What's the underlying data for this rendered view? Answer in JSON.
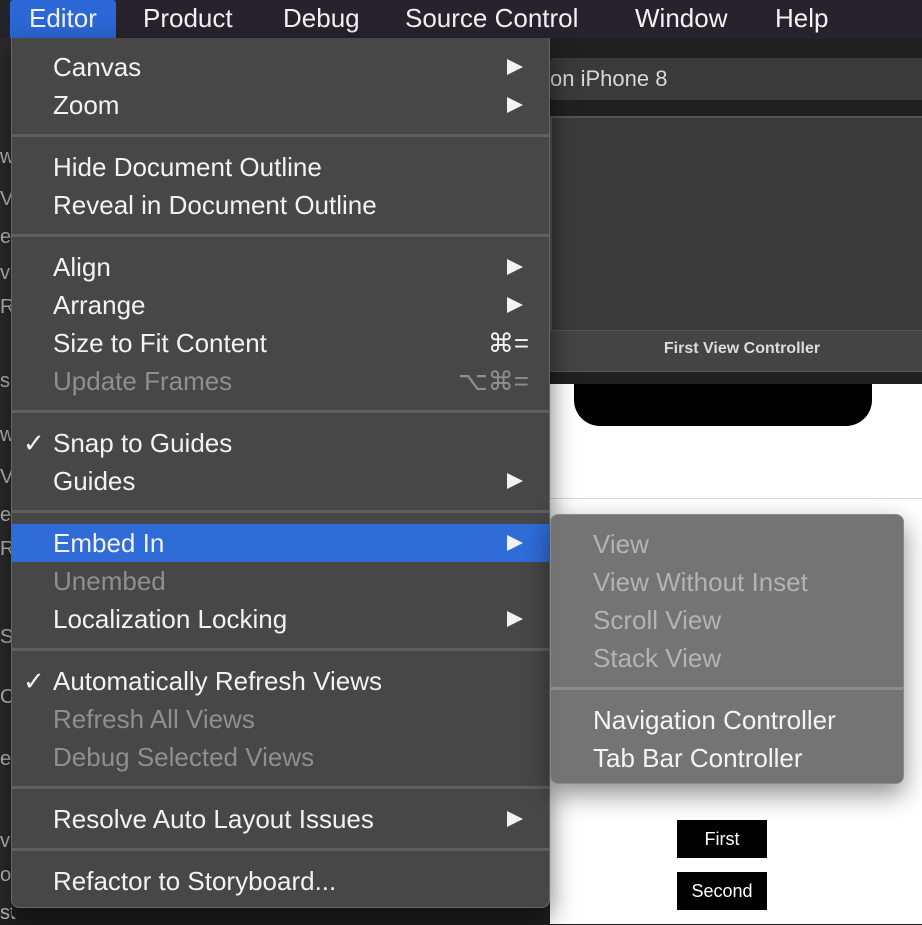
{
  "menubar": {
    "items": [
      {
        "label": "Editor",
        "active": true
      },
      {
        "label": "Product"
      },
      {
        "label": "Debug"
      },
      {
        "label": "Source Control"
      },
      {
        "label": "Window"
      },
      {
        "label": "Help"
      }
    ]
  },
  "background": {
    "device_label": "on iPhone 8",
    "scene_title": "First View Controller",
    "button_first": "First",
    "button_second": "Second",
    "left_fragments": [
      "w",
      "V",
      "e",
      "v",
      "R",
      "s",
      "w",
      "V",
      "e",
      "R",
      "S",
      "C",
      "e",
      "v",
      "o",
      "st"
    ]
  },
  "editor_menu": {
    "canvas": {
      "label": "Canvas"
    },
    "zoom": {
      "label": "Zoom"
    },
    "hide_outline": {
      "label": "Hide Document Outline"
    },
    "reveal_outline": {
      "label": "Reveal in Document Outline"
    },
    "align": {
      "label": "Align"
    },
    "arrange": {
      "label": "Arrange"
    },
    "size_to_fit": {
      "label": "Size to Fit Content",
      "shortcut": "⌘="
    },
    "update_frames": {
      "label": "Update Frames",
      "shortcut": "⌥⌘="
    },
    "snap_to_guides": {
      "label": "Snap to Guides",
      "check": "✓"
    },
    "guides": {
      "label": "Guides"
    },
    "embed_in": {
      "label": "Embed In"
    },
    "unembed": {
      "label": "Unembed"
    },
    "localization_locking": {
      "label": "Localization Locking"
    },
    "auto_refresh": {
      "label": "Automatically Refresh Views",
      "check": "✓"
    },
    "refresh_all": {
      "label": "Refresh All Views"
    },
    "debug_selected": {
      "label": "Debug Selected Views"
    },
    "resolve_auto_layout": {
      "label": "Resolve Auto Layout Issues"
    },
    "refactor": {
      "label": "Refactor to Storyboard..."
    }
  },
  "embed_submenu": {
    "view": "View",
    "view_without_inset": "View Without Inset",
    "scroll_view": "Scroll View",
    "stack_view": "Stack View",
    "navigation_controller": "Navigation Controller",
    "tab_bar_controller": "Tab Bar Controller"
  },
  "colors": {
    "menu_highlight": "#2f6cd8",
    "menubar_active": "#2b67d6"
  }
}
